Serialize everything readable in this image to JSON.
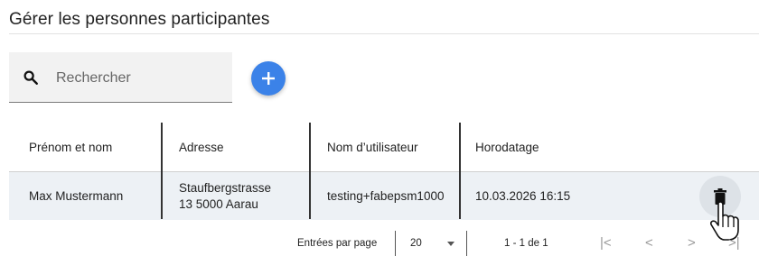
{
  "page": {
    "title": "Gérer les personnes participantes"
  },
  "search": {
    "placeholder": "Rechercher",
    "icon": "search-icon"
  },
  "add_button": {
    "icon": "plus-icon",
    "color": "#3b82e8"
  },
  "table": {
    "columns": [
      "Prénom et nom",
      "Adresse",
      "Nom d’utilisateur",
      "Horodatage"
    ],
    "rows": [
      {
        "name": "Max Mustermann",
        "address_line1": "Staufbergstrasse",
        "address_line2": "13 5000 Aarau",
        "username": "testing+fabepsm1000",
        "timestamp": "10.03.2026 16:15",
        "action_icon": "trash-icon"
      }
    ]
  },
  "pagination": {
    "entries_label": "Entrées par page",
    "per_page": "20",
    "range": "1 - 1 de 1",
    "first": "|<",
    "prev": "<",
    "next": ">",
    "last": ">|"
  }
}
